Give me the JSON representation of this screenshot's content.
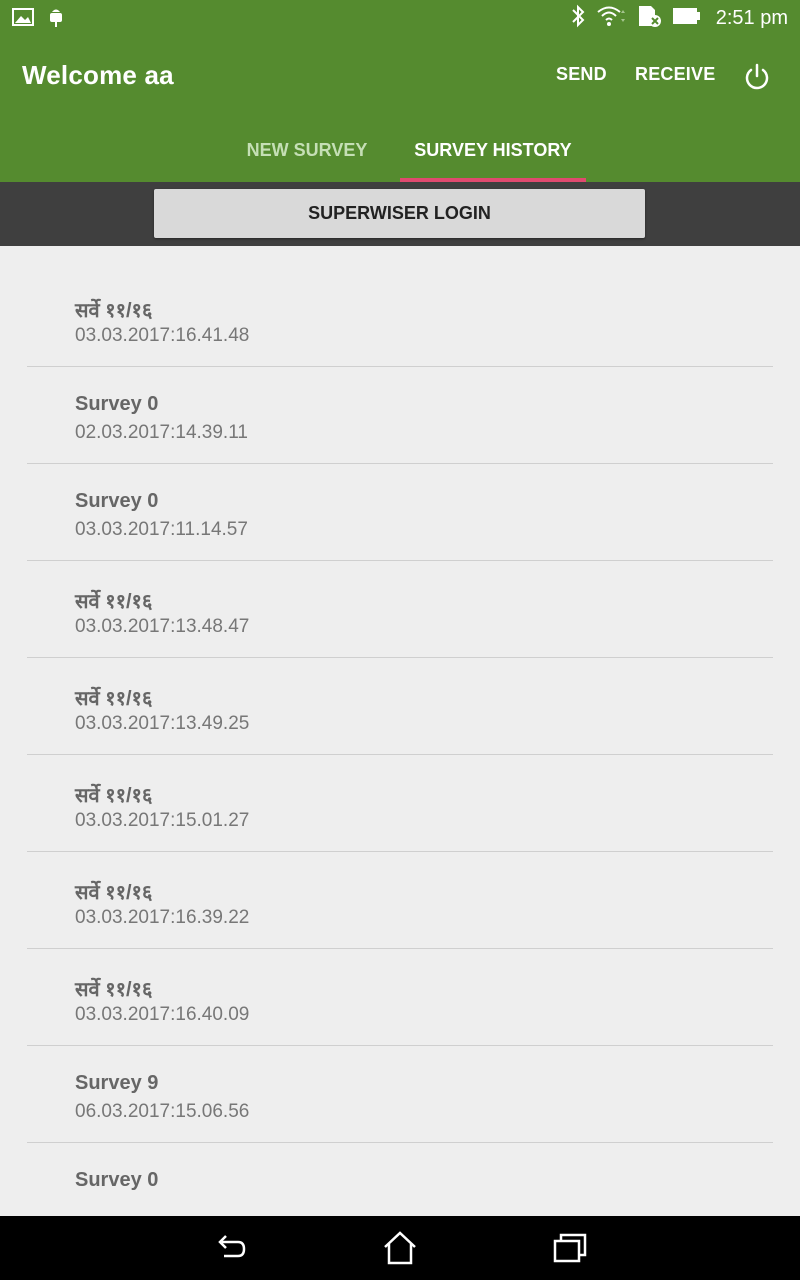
{
  "status_bar": {
    "time": "2:51 pm",
    "icons": [
      "gallery-icon",
      "android-debug-icon",
      "bluetooth-icon",
      "wifi-icon",
      "sd-card-icon",
      "battery-icon"
    ]
  },
  "app_bar": {
    "title": "Welcome aa",
    "send_label": "SEND",
    "receive_label": "RECEIVE",
    "power_icon": "power-icon",
    "color": "#558b2f"
  },
  "tabs": [
    {
      "label": "NEW SURVEY",
      "selected": false
    },
    {
      "label": "SURVEY HISTORY",
      "selected": true
    }
  ],
  "supervisor_button": {
    "label": "SUPERWISER LOGIN"
  },
  "surveys": [
    {
      "name": "सर्वे ११/१६",
      "date": "03.03.2017:16.41.48"
    },
    {
      "name": "Survey 0",
      "date": "02.03.2017:14.39.11"
    },
    {
      "name": "Survey 0",
      "date": "03.03.2017:11.14.57"
    },
    {
      "name": "सर्वे ११/१६",
      "date": "03.03.2017:13.48.47"
    },
    {
      "name": "सर्वे ११/१६",
      "date": "03.03.2017:13.49.25"
    },
    {
      "name": "सर्वे ११/१६",
      "date": "03.03.2017:15.01.27"
    },
    {
      "name": "सर्वे ११/१६",
      "date": "03.03.2017:16.39.22"
    },
    {
      "name": "सर्वे ११/१६",
      "date": "03.03.2017:16.40.09"
    },
    {
      "name": "Survey 9",
      "date": "06.03.2017:15.06.56"
    },
    {
      "name": "Survey 0",
      "date": ""
    }
  ],
  "nav_bar": {
    "icons": [
      "back-icon",
      "home-icon",
      "recents-icon"
    ]
  },
  "colors": {
    "accent_indicator": "#e04a6f",
    "background": "#eeeeee"
  }
}
